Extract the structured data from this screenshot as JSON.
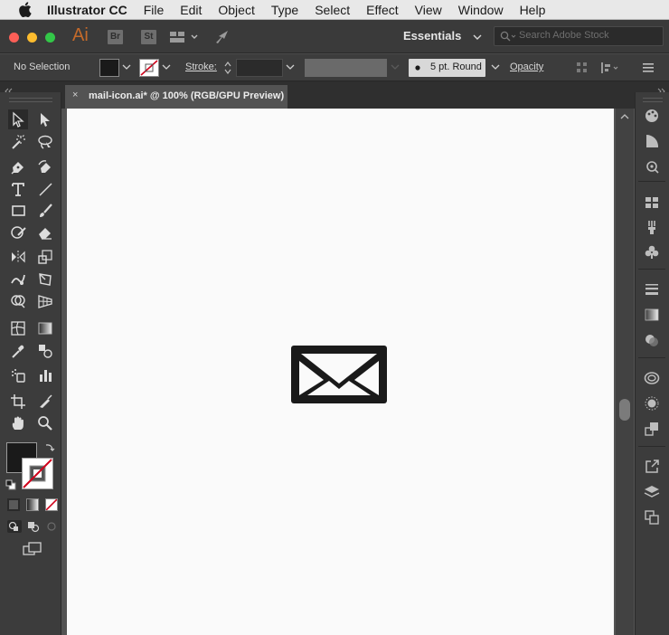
{
  "menubar": {
    "app_name": "Illustrator CC",
    "items": [
      "File",
      "Edit",
      "Object",
      "Type",
      "Select",
      "Effect",
      "View",
      "Window",
      "Help"
    ]
  },
  "appbar": {
    "logo": "Ai",
    "bridge_label": "Br",
    "stock_label": "St",
    "workspace": "Essentials",
    "search_placeholder": "Search Adobe Stock"
  },
  "controlbar": {
    "selection": "No Selection",
    "stroke_label": "Stroke:",
    "brush": "5 pt. Round",
    "opacity_label": "Opacity"
  },
  "document": {
    "tab_title": "mail-icon.ai* @ 100% (RGB/GPU Preview)",
    "close_glyph": "×"
  },
  "icons": {
    "apple": "apple-icon",
    "artwork": "mail-envelope-icon"
  },
  "colors": {
    "close_light": "#fc5f57",
    "minimize_light": "#fdbc2e",
    "zoom_light": "#33c748",
    "ai_brand": "#c46a2a",
    "fill": "#1a1a1a",
    "stroke_none": "#d0021b"
  }
}
